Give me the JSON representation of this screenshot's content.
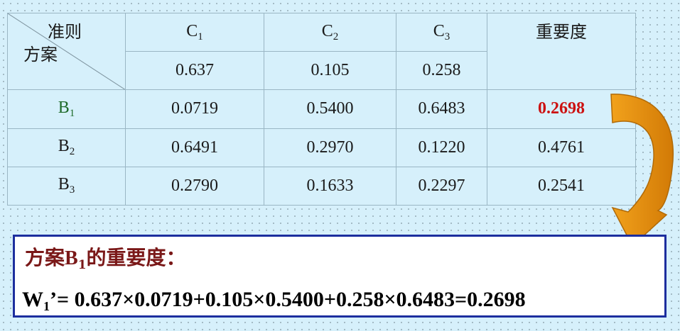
{
  "table": {
    "criteria_label": "准则",
    "alternatives_label": "方案",
    "columns": [
      {
        "label": "C",
        "sub": "1",
        "weight": "0.637"
      },
      {
        "label": "C",
        "sub": "2",
        "weight": "0.105"
      },
      {
        "label": "C",
        "sub": "3",
        "weight": "0.258"
      }
    ],
    "importance_label": "重要度",
    "rows": [
      {
        "label": "B",
        "sub": "1",
        "values": [
          "0.0719",
          "0.5400",
          "0.6483"
        ],
        "importance": "0.2698"
      },
      {
        "label": "B",
        "sub": "2",
        "values": [
          "0.6491",
          "0.2970",
          "0.1220"
        ],
        "importance": "0.4761"
      },
      {
        "label": "B",
        "sub": "3",
        "values": [
          "0.2790",
          "0.1633",
          "0.2297"
        ],
        "importance": "0.2541"
      }
    ]
  },
  "formula_box": {
    "title_prefix": "方案",
    "title_var": "B",
    "title_sub": "1",
    "title_suffix": "的重要度：",
    "lhs_var": "W",
    "lhs_sub": "1",
    "expression": "’= 0.637×0.0719+0.105×0.5400+0.258×0.6483=0.2698"
  },
  "colors": {
    "background": "#d6f0fb",
    "highlight_value": "#cc1111",
    "row1_label": "#1f6b2a",
    "box_border": "#1c2e9e",
    "title_text": "#7a1818",
    "arrow_fill": "#e8900a"
  }
}
